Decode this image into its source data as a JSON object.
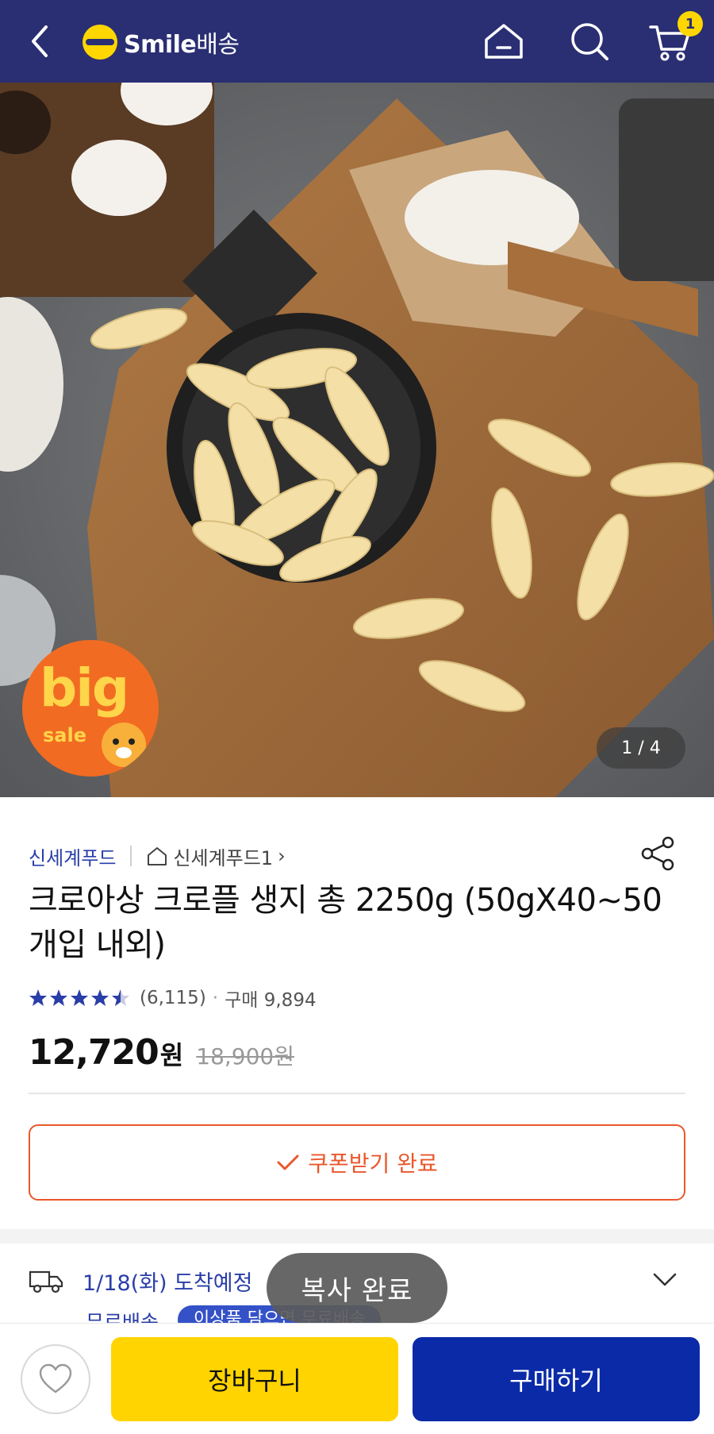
{
  "header": {
    "logo_brand": "Smile",
    "logo_suffix": "배송",
    "cart_count": "1",
    "icons": [
      "back-arrow-icon",
      "home-icon",
      "search-icon",
      "cart-icon"
    ]
  },
  "gallery": {
    "counter": "1 / 4",
    "badge_big": "big",
    "badge_sale": "sale"
  },
  "product": {
    "seller": "신세계푸드",
    "store": "신세계푸드1",
    "store_chevron": "›",
    "title": "크로아상 크로플 생지 총 2250g (50gX40~50개입 내외)",
    "rating": 4.5,
    "review_count": "(6,115)",
    "purchases": "구매 9,894",
    "price": "12,720",
    "price_unit": "원",
    "original_price": "18,900원"
  },
  "coupon": {
    "label": "쿠폰받기 완료"
  },
  "delivery": {
    "arrival": "1/18(화) 도착예정",
    "free_shipping": "무료배송",
    "pill": "이상품 담으면 무료배송"
  },
  "toast": {
    "message": "복사 완료"
  },
  "bottom_bar": {
    "cart_label": "장바구니",
    "buy_label": "구매하기"
  },
  "colors": {
    "header_bg": "#2a2e72",
    "brand_yellow": "#ffd600",
    "coupon_accent": "#e9572b",
    "buy_button": "#0a2aa8",
    "star": "#2a3ea8"
  }
}
